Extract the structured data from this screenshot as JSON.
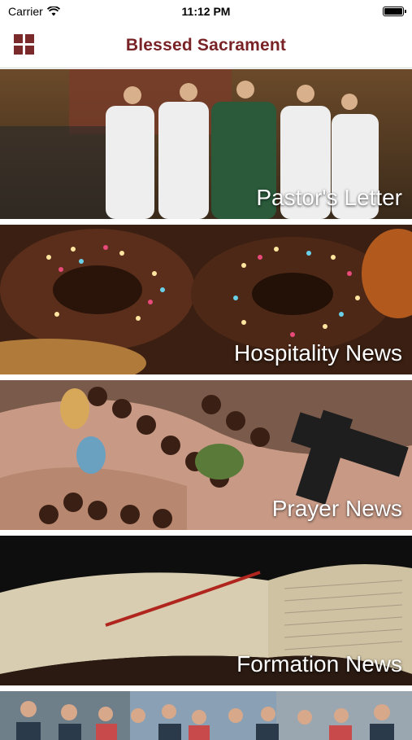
{
  "status_bar": {
    "carrier": "Carrier",
    "time": "11:12 PM"
  },
  "header": {
    "title": "Blessed Sacrament",
    "menu_icon": "grid-menu-icon"
  },
  "colors": {
    "brand": "#7a2327"
  },
  "feed": {
    "items": [
      {
        "label": "Pastor's Letter"
      },
      {
        "label": "Hospitality News"
      },
      {
        "label": "Prayer News"
      },
      {
        "label": "Formation News"
      }
    ]
  }
}
